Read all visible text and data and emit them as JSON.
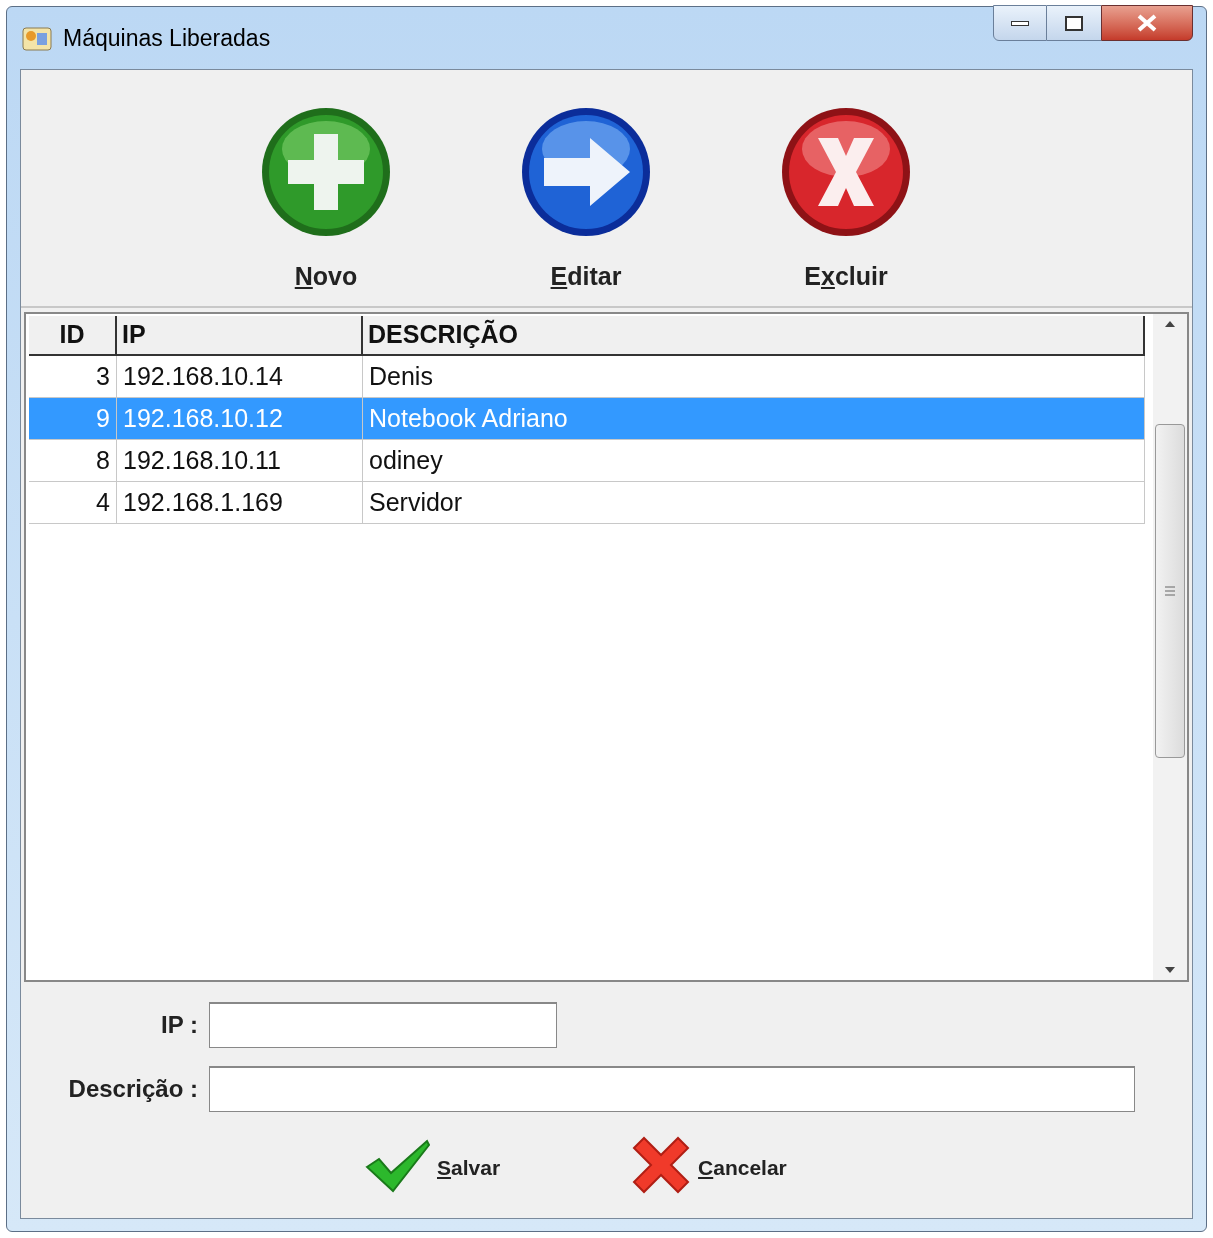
{
  "window": {
    "title": "Máquinas Liberadas"
  },
  "toolbar": [
    {
      "kind": "add",
      "key": "N",
      "after": "ovo"
    },
    {
      "kind": "edit",
      "key": "E",
      "after": "ditar"
    },
    {
      "kind": "delete",
      "key": "x",
      "before": "E",
      "after": "cluir"
    }
  ],
  "table": {
    "columns": [
      "ID",
      "IP",
      "DESCRIÇÃO"
    ],
    "rows": [
      {
        "cells": [
          "3",
          "192.168.10.14",
          "Denis"
        ],
        "selected": false
      },
      {
        "cells": [
          "9",
          "192.168.10.12",
          "Notebook Adriano"
        ],
        "selected": true
      },
      {
        "cells": [
          "8",
          "192.168.10.11",
          "odiney"
        ],
        "selected": false
      },
      {
        "cells": [
          "4",
          "192.168.1.169",
          "Servidor"
        ],
        "selected": false
      }
    ]
  },
  "form": [
    {
      "label": "IP :"
    },
    {
      "label": "Descrição :"
    }
  ],
  "buttons": [
    {
      "kind": "save",
      "key": "S",
      "after": "alvar"
    },
    {
      "kind": "cancel",
      "key": "C",
      "after": "ancelar"
    }
  ]
}
